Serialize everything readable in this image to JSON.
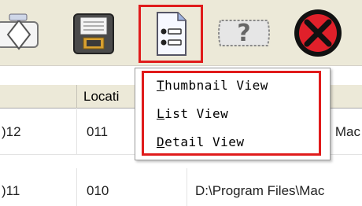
{
  "toolbar": {
    "buttons": [
      {
        "name": "open",
        "icon": "diamond-document-icon"
      },
      {
        "name": "save",
        "icon": "floppy-save-icon"
      },
      {
        "name": "view",
        "icon": "view-list-icon"
      },
      {
        "name": "help",
        "icon": "help-question-icon"
      },
      {
        "name": "exit",
        "icon": "stop-x-icon"
      }
    ]
  },
  "menu": {
    "items": [
      {
        "accel": "T",
        "rest": "humbnail View"
      },
      {
        "accel": "L",
        "rest": "ist View"
      },
      {
        "accel": "D",
        "rest": "etail View"
      }
    ]
  },
  "grid": {
    "headers": [
      "",
      "Locati",
      ""
    ],
    "rows": [
      {
        "col1": ")12",
        "col2": "011",
        "col3": "Mac"
      },
      {
        "col1": ")11",
        "col2": "010",
        "col3": "D:\\Program Files\\Mac"
      }
    ]
  },
  "colors": {
    "highlight": "#e01b1b",
    "toolbar_bg": "#ece9d8"
  }
}
